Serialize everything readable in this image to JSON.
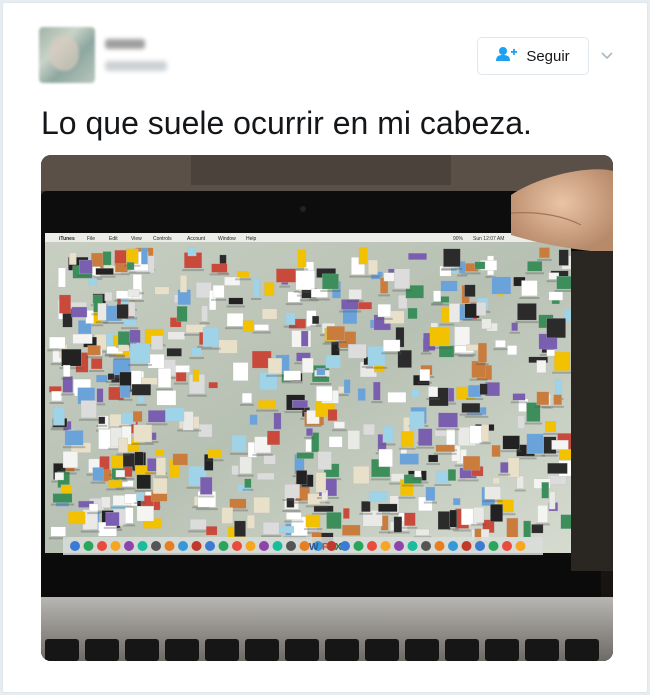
{
  "tweet": {
    "follow_label": "Seguir",
    "text": "Lo que suele ocurrir en mi cabeza."
  },
  "photo": {
    "menubar": {
      "items": [
        "iTunes",
        "File",
        "Edit",
        "View",
        "Controls",
        "Account",
        "Window",
        "Help"
      ],
      "clock": "Sun 12:07 AM",
      "battery": "90%"
    },
    "dock_letters": [
      "W",
      "P",
      "X"
    ]
  },
  "colors": {
    "follow_icon": "#1da1f2",
    "text": "#14171a",
    "border": "#e1e8ed"
  },
  "icons": [
    "follow-user-icon",
    "chevron-down-icon"
  ]
}
